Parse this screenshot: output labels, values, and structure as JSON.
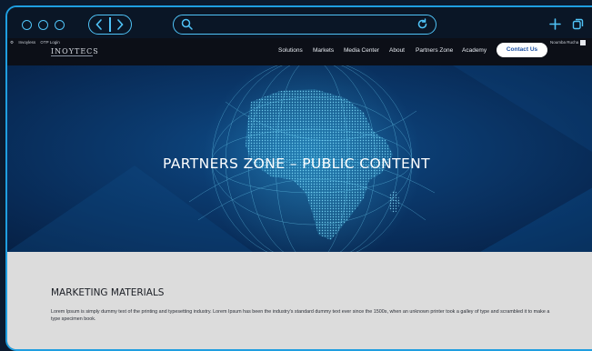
{
  "browser": {
    "window_controls": [
      "circle",
      "circle",
      "circle"
    ],
    "back_icon": "chevron-left-icon",
    "forward_icon": "chevron-right-icon",
    "search_icon": "search-icon",
    "reload_icon": "reload-icon",
    "new_tab_icon": "plus-icon",
    "tabs_icon": "tabs-copy-icon",
    "accent_color": "#4fc3f7"
  },
  "site": {
    "utility": {
      "settings_icon": "gear-icon",
      "brand_label": "Invoyless",
      "otp_label": "OTP Login"
    },
    "logo_text": "INOYTECS",
    "nav": {
      "items": [
        "Solutions",
        "Markets",
        "Media Center",
        "About",
        "Partners Zone",
        "Academy"
      ],
      "cta_label": "Contact Us"
    },
    "user": {
      "name": "Noumba Rucha"
    },
    "hero": {
      "title": "PARTNERS ZONE – PUBLIC CONTENT"
    },
    "section": {
      "title": "MARKETING MATERIALS",
      "text": "Lorem Ipsum is simply dummy text of the printing and typesetting industry. Lorem Ipsum has been the industry's standard dummy text ever since the 1500s, when an unknown printer took a galley of type and scrambled it to make a type specimen book."
    },
    "colors": {
      "hero_blue": "#0b3a6e",
      "cta_text": "#1a4fa3",
      "content_bg": "#dcdcdc"
    }
  }
}
